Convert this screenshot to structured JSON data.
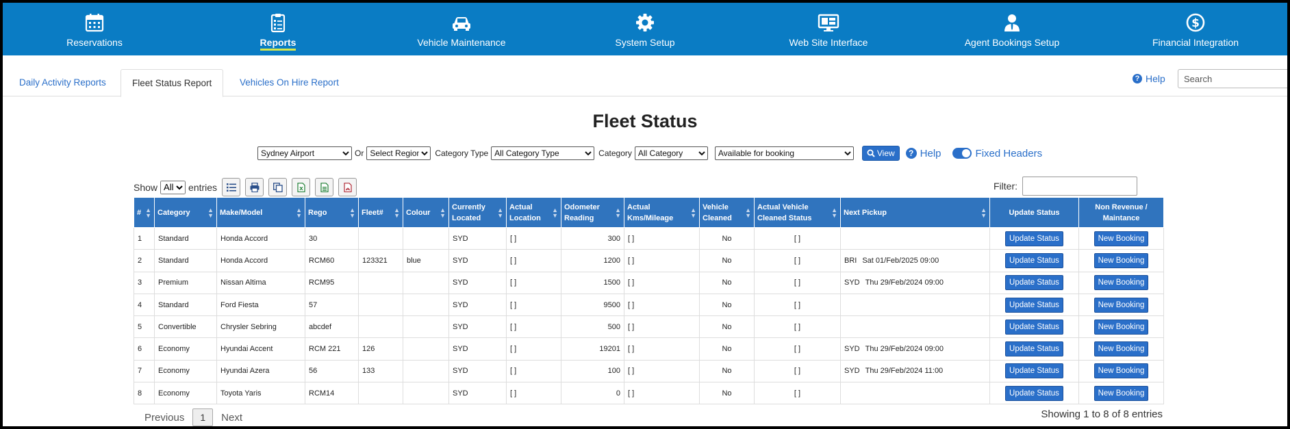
{
  "nav": [
    {
      "label": "Reservations",
      "icon": "calendar-icon",
      "active": false
    },
    {
      "label": "Reports",
      "icon": "clipboard-icon",
      "active": true
    },
    {
      "label": "Vehicle Maintenance",
      "icon": "car-icon",
      "active": false
    },
    {
      "label": "System Setup",
      "icon": "gear-icon",
      "active": false
    },
    {
      "label": "Web Site Interface",
      "icon": "monitor-icon",
      "active": false
    },
    {
      "label": "Agent Bookings Setup",
      "icon": "agent-icon",
      "active": false
    },
    {
      "label": "Financial Integration",
      "icon": "dollar-icon",
      "active": false
    }
  ],
  "tabs": [
    "Daily Activity Reports",
    "Fleet Status Report",
    "Vehicles On Hire Report"
  ],
  "help_label": "Help",
  "search_placeholder": "Search",
  "title": "Fleet Status",
  "filters": {
    "location": "Sydney Airport",
    "or_label": "Or",
    "region": "Select Region",
    "category_type_label": "Category Type",
    "category_type": "All Category Type",
    "category_label": "Category",
    "category": "All Category",
    "availability": "Available for booking",
    "view_label": "View",
    "help_label": "Help",
    "fixed_headers_label": "Fixed Headers"
  },
  "show": {
    "show_label": "Show",
    "value": "All",
    "entries_label": "entries",
    "filter_label": "Filter:"
  },
  "columns": [
    "#",
    "Category",
    "Make/Model",
    "Rego",
    "Fleet#",
    "Colour",
    "Currently Located",
    "Actual Location",
    "Odometer Reading",
    "Actual Kms/Mileage",
    "Vehicle Cleaned",
    "Actual Vehicle Cleaned Status",
    "Next Pickup",
    "Update Status",
    "Non Revenue / Maintance"
  ],
  "rows": [
    {
      "n": "1",
      "category": "Standard",
      "make": "Honda Accord",
      "rego": "30",
      "fleet": "",
      "colour": "",
      "located": "SYD",
      "actual_location": "[           ]",
      "odometer": "300",
      "kms": "[           ]",
      "cleaned": "No",
      "cleaned_status": "[           ]",
      "pickup_loc": "",
      "pickup_date": ""
    },
    {
      "n": "2",
      "category": "Standard",
      "make": "Honda Accord",
      "rego": "RCM60",
      "fleet": "123321",
      "colour": "blue",
      "located": "SYD",
      "actual_location": "[           ]",
      "odometer": "1200",
      "kms": "[           ]",
      "cleaned": "No",
      "cleaned_status": "[           ]",
      "pickup_loc": "BRI",
      "pickup_date": "Sat 01/Feb/2025 09:00"
    },
    {
      "n": "3",
      "category": "Premium",
      "make": "Nissan Altima",
      "rego": "RCM95",
      "fleet": "",
      "colour": "",
      "located": "SYD",
      "actual_location": "[           ]",
      "odometer": "1500",
      "kms": "[           ]",
      "cleaned": "No",
      "cleaned_status": "[           ]",
      "pickup_loc": "SYD",
      "pickup_date": "Thu 29/Feb/2024 09:00"
    },
    {
      "n": "4",
      "category": "Standard",
      "make": "Ford Fiesta",
      "rego": "57",
      "fleet": "",
      "colour": "",
      "located": "SYD",
      "actual_location": "[           ]",
      "odometer": "9500",
      "kms": "[           ]",
      "cleaned": "No",
      "cleaned_status": "[           ]",
      "pickup_loc": "",
      "pickup_date": ""
    },
    {
      "n": "5",
      "category": "Convertible",
      "make": "Chrysler Sebring",
      "rego": "abcdef",
      "fleet": "",
      "colour": "",
      "located": "SYD",
      "actual_location": "[           ]",
      "odometer": "500",
      "kms": "[           ]",
      "cleaned": "No",
      "cleaned_status": "[           ]",
      "pickup_loc": "",
      "pickup_date": ""
    },
    {
      "n": "6",
      "category": "Economy",
      "make": "Hyundai Accent",
      "rego": "RCM 221",
      "fleet": "126",
      "colour": "",
      "located": "SYD",
      "actual_location": "[           ]",
      "odometer": "19201",
      "kms": "[           ]",
      "cleaned": "No",
      "cleaned_status": "[           ]",
      "pickup_loc": "SYD",
      "pickup_date": "Thu 29/Feb/2024 09:00"
    },
    {
      "n": "7",
      "category": "Economy",
      "make": "Hyundai Azera",
      "rego": "56",
      "fleet": "133",
      "colour": "",
      "located": "SYD",
      "actual_location": "[           ]",
      "odometer": "100",
      "kms": "[           ]",
      "cleaned": "No",
      "cleaned_status": "[           ]",
      "pickup_loc": "SYD",
      "pickup_date": "Thu 29/Feb/2024 11:00"
    },
    {
      "n": "8",
      "category": "Economy",
      "make": "Toyota Yaris",
      "rego": "RCM14",
      "fleet": "",
      "colour": "",
      "located": "SYD",
      "actual_location": "[           ]",
      "odometer": "0",
      "kms": "[           ]",
      "cleaned": "No",
      "cleaned_status": "[           ]",
      "pickup_loc": "",
      "pickup_date": ""
    }
  ],
  "row_buttons": {
    "update": "Update Status",
    "booking": "New Booking"
  },
  "pager": {
    "previous": "Previous",
    "page": "1",
    "next": "Next"
  },
  "showing": "Showing 1 to 8 of 8 entries",
  "colors": {
    "nav_bg": "#0a7cc4",
    "header_bg": "#3074be",
    "accent": "#2a6fc9"
  }
}
